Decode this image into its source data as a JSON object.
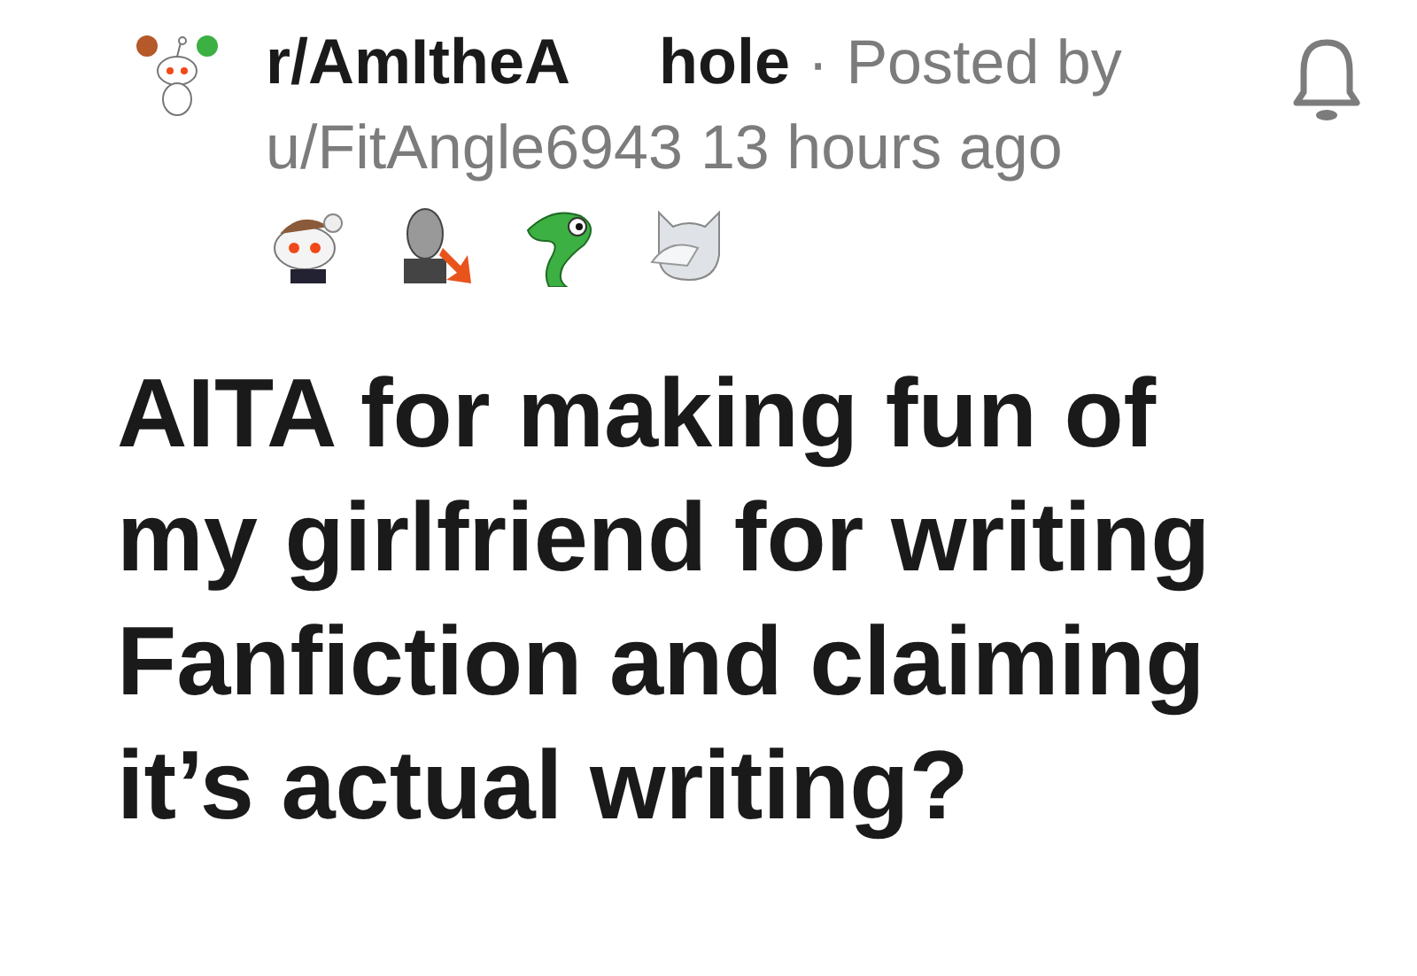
{
  "post_header": {
    "subreddit_start": "r/AmItheA",
    "subreddit_end": "hole",
    "separator": "·",
    "posted_by": "Posted by",
    "author": "u/FitAngle6943",
    "time": "13 hours ago"
  },
  "awards": [
    {
      "kind": "snoo"
    },
    {
      "kind": "facepalm-man"
    },
    {
      "kind": "snake"
    },
    {
      "kind": "cat"
    }
  ],
  "title_lines": [
    "AITA for making fun of",
    "my girlfriend for writing",
    "Fanfiction and claiming",
    "it’s actual writing?"
  ]
}
